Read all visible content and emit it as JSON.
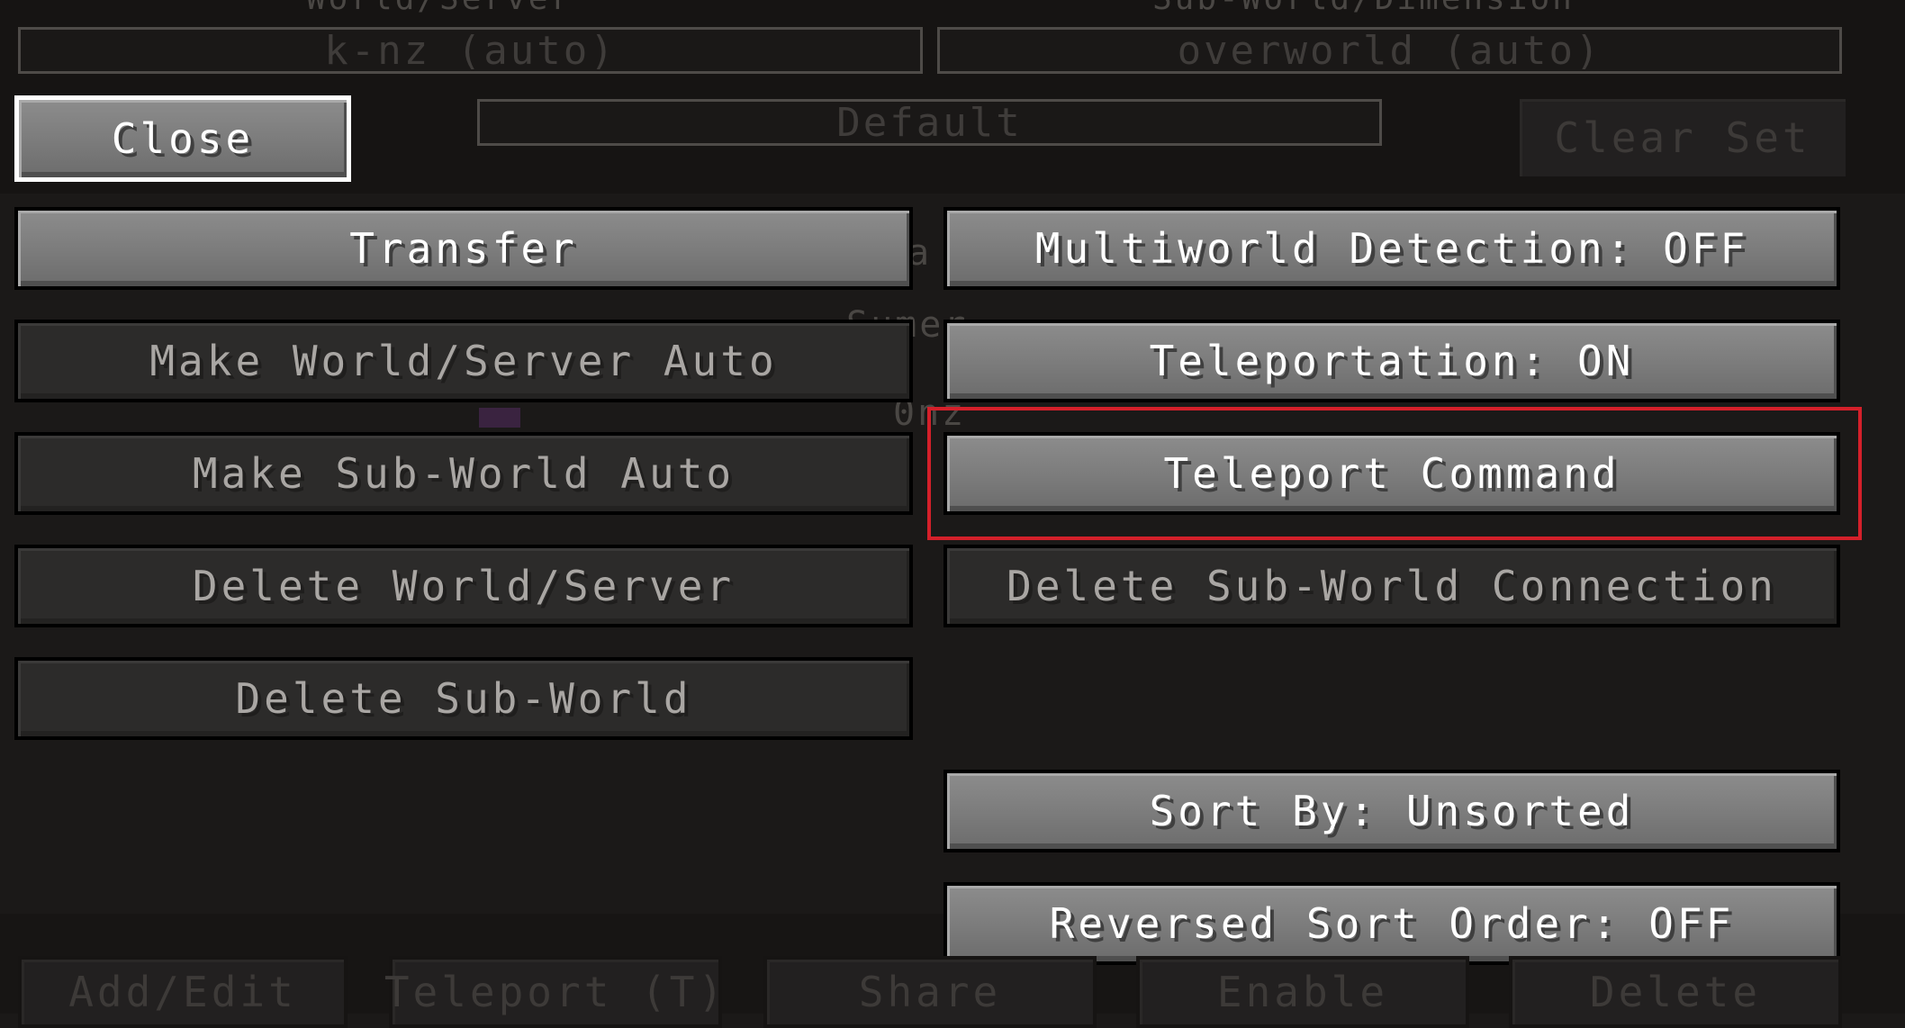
{
  "background_texts": {
    "top_left_label": "World/Server",
    "top_right_label": "Sub-World/Dimension",
    "frag_1": "a",
    "frag_2": "Sumer",
    "frag_3": "0nz"
  },
  "fields": {
    "world_server": "k-nz (auto)",
    "sub_world": "overworld (auto)",
    "waypoint_set": "Default"
  },
  "header_buttons": {
    "close": "Close",
    "clear_set": "Clear Set"
  },
  "left_buttons": {
    "transfer": "Transfer",
    "make_world_server_auto": "Make World/Server Auto",
    "make_sub_world_auto": "Make Sub-World Auto",
    "delete_world_server": "Delete World/Server",
    "delete_sub_world": "Delete Sub-World"
  },
  "right_buttons": {
    "multiworld_detection": "Multiworld Detection: OFF",
    "teleportation": "Teleportation: ON",
    "teleport_command": "Teleport Command",
    "delete_sub_world_connection": "Delete Sub-World Connection",
    "sort_by": "Sort By: Unsorted",
    "reversed_sort_order": "Reversed Sort Order: OFF"
  },
  "bottom_bar": {
    "add_edit": "Add/Edit",
    "teleport": "Teleport (T)",
    "share": "Share",
    "enable": "Enable",
    "delete": "Delete"
  },
  "colors": {
    "highlight": "#d4202a",
    "focus_outline": "#ffffff"
  }
}
